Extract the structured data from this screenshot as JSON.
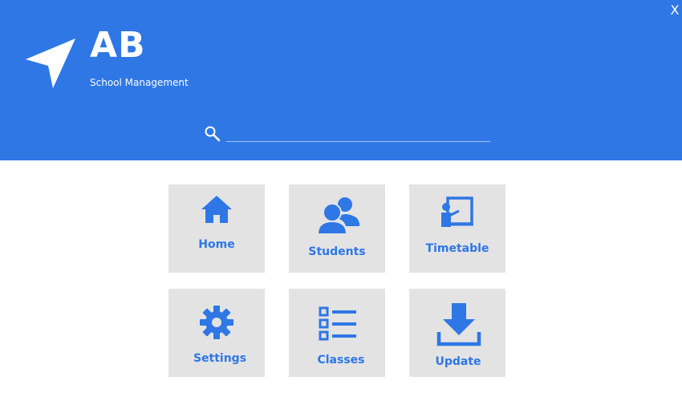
{
  "window": {
    "close_label": "X"
  },
  "brand": {
    "title": "AB",
    "subtitle": "School Management",
    "logo_icon": "navigation-arrow-icon"
  },
  "search": {
    "value": "",
    "placeholder": "",
    "icon": "search-icon"
  },
  "colors": {
    "header_bg": "#2e77e5",
    "tile_bg": "#e3e3e3",
    "tile_text": "#2e77e5"
  },
  "tiles": [
    {
      "label": "Home",
      "icon": "home-icon"
    },
    {
      "label": "Students",
      "icon": "students-icon"
    },
    {
      "label": "Timetable",
      "icon": "timetable-icon"
    },
    {
      "label": "Settings",
      "icon": "gear-icon"
    },
    {
      "label": "Classes",
      "icon": "list-icon"
    },
    {
      "label": "Update",
      "icon": "download-icon"
    }
  ]
}
